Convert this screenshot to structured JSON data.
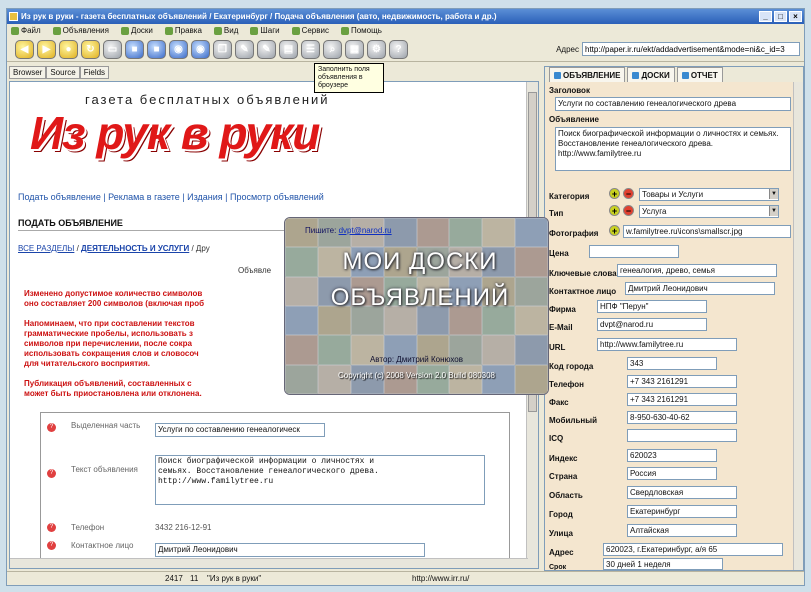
{
  "window": {
    "title": "Из рук в руки - газета бесплатных объявлений / Екатеринбург / Подача объявления (авто, недвижимость, работа и др.)",
    "controls": [
      "_",
      "□",
      "×"
    ]
  },
  "menu": [
    "Файл",
    "Объявления",
    "Доски",
    "Правка",
    "Вид",
    "Шаги",
    "Сервис",
    "Помощь"
  ],
  "toolbar": {
    "address_label": "Адрес",
    "address_value": "http://paper.ir.ru/ekt/addadvertisement&mode=ni&c_id=3",
    "tooltip": "Заполнить поля объявления в броузере"
  },
  "left_tabs": [
    "Browser",
    "Source",
    "Fields"
  ],
  "page": {
    "gazeta": "газета бесплатных объявлений",
    "logo": "Из рук в руки",
    "nav": "Подать объявление | Реклама в газете | Издания | Просмотр объявлений",
    "section_title": "ПОДАТЬ ОБЪЯВЛЕНИЕ",
    "crumb_all": "ВСЕ РАЗДЕЛЫ",
    "crumb_sep": " / ",
    "crumb_active": "ДЕЯТЕЛЬНОСТЬ И УСЛУГИ",
    "crumb_rest": " / Дру",
    "ad_title": "Объявле",
    "warning1_line1": "Изменено допустимое количество символов",
    "warning1_line2": "оно составляет 200 символов (включая проб",
    "warning2_line1": "Напоминаем, что при составлении текстов",
    "warning2_line2": "грамматические пробелы, использовать з",
    "warning2_line3": "символов при перечислении, после сокра",
    "warning2_line4": "использовать сокращения слов и словосоч",
    "warning2_line5": "для читательского восприятия.",
    "warning3_line1": "Публикация объявлений, составленных с",
    "warning3_line2": "может быть приостановлена или отклонена."
  },
  "form": {
    "highlight_label": "Выделенная часть",
    "highlight_value": "Услуги по составлению генеалогическ",
    "text_label": "Текст объявления",
    "text_value": "Поиск биографической информации о личностях и\nсемьях. Восстановление генеалогического древа.\nhttp://www.familytree.ru",
    "phone_label": "Телефон",
    "phone_value": "3432 216-12-91",
    "contact_label": "Контактное лицо",
    "contact_value": "Дмитрий Леонидович"
  },
  "status": {
    "count": "2417",
    "num": "11",
    "site": "\"Из рук в руки\"",
    "url": "http://www.irr.ru/"
  },
  "splash": {
    "email_label": "Пишите:",
    "email": "dvpt@narod.ru",
    "title_line1": "МОИ ДОСКИ",
    "title_line2": "ОБЪЯВЛЕНИЙ",
    "author": "Автор: Дмитрий Конюхов",
    "copyright": "Copyright (c) 2008 Version 2.0 Build 080308"
  },
  "right_panel": {
    "tabs": [
      "ОБЪЯВЛЕНИЕ",
      "ДОСКИ",
      "ОТЧЕТ"
    ],
    "header_label": "Заголовок",
    "header_value": "Услуги по составлению генеалогического древа",
    "ad_label": "Объявление",
    "ad_value": "Поиск биографической информации о личностях и семьях. Восстановление генеалогического древа. http://www.familytree.ru",
    "category_label": "Категория",
    "category_value": "Товары и Услуги",
    "type_label": "Тип",
    "type_value": "Услуга",
    "photo_label": "Фотография",
    "photo_value": "w.familytree.ru\\icons\\smallscr.jpg",
    "price_label": "Цена",
    "price_value": "",
    "keywords_label": "Ключевые слова",
    "keywords_value": "генеалогия, древо, семья",
    "contact_label": "Контактное лицо",
    "contact_value": "Дмитрий Леонидович",
    "firm_label": "Фирма",
    "firm_value": "НПФ \"Перун\"",
    "email_label": "E-Mail",
    "email_value": "dvpt@narod.ru",
    "url_label": "URL",
    "url_value": "http://www.familytree.ru",
    "citycode_label": "Код города",
    "citycode_value": "343",
    "phone_label": "Телефон",
    "phone_value": "+7 343 2161291",
    "fax_label": "Факс",
    "fax_value": "+7 343 2161291",
    "mobile_label": "Мобильный",
    "mobile_value": "8-950-630-40-62",
    "icq_label": "ICQ",
    "icq_value": "",
    "index_label": "Индекс",
    "index_value": "620023",
    "country_label": "Страна",
    "country_value": "Россия",
    "region_label": "Область",
    "region_value": "Свердловская",
    "city_label": "Город",
    "city_value": "Екатеринбург",
    "street_label": "Улица",
    "street_value": "Алтайская",
    "address_label": "Адрес",
    "address_value": "620023, г.Екатеринбург, а/я 65",
    "term_label": "Срок",
    "term_value": "30 дней 1 неделя"
  },
  "colors": {
    "accent_red": "#e01818",
    "link_blue": "#2255aa",
    "panel_bg": "#f4e6cf"
  }
}
